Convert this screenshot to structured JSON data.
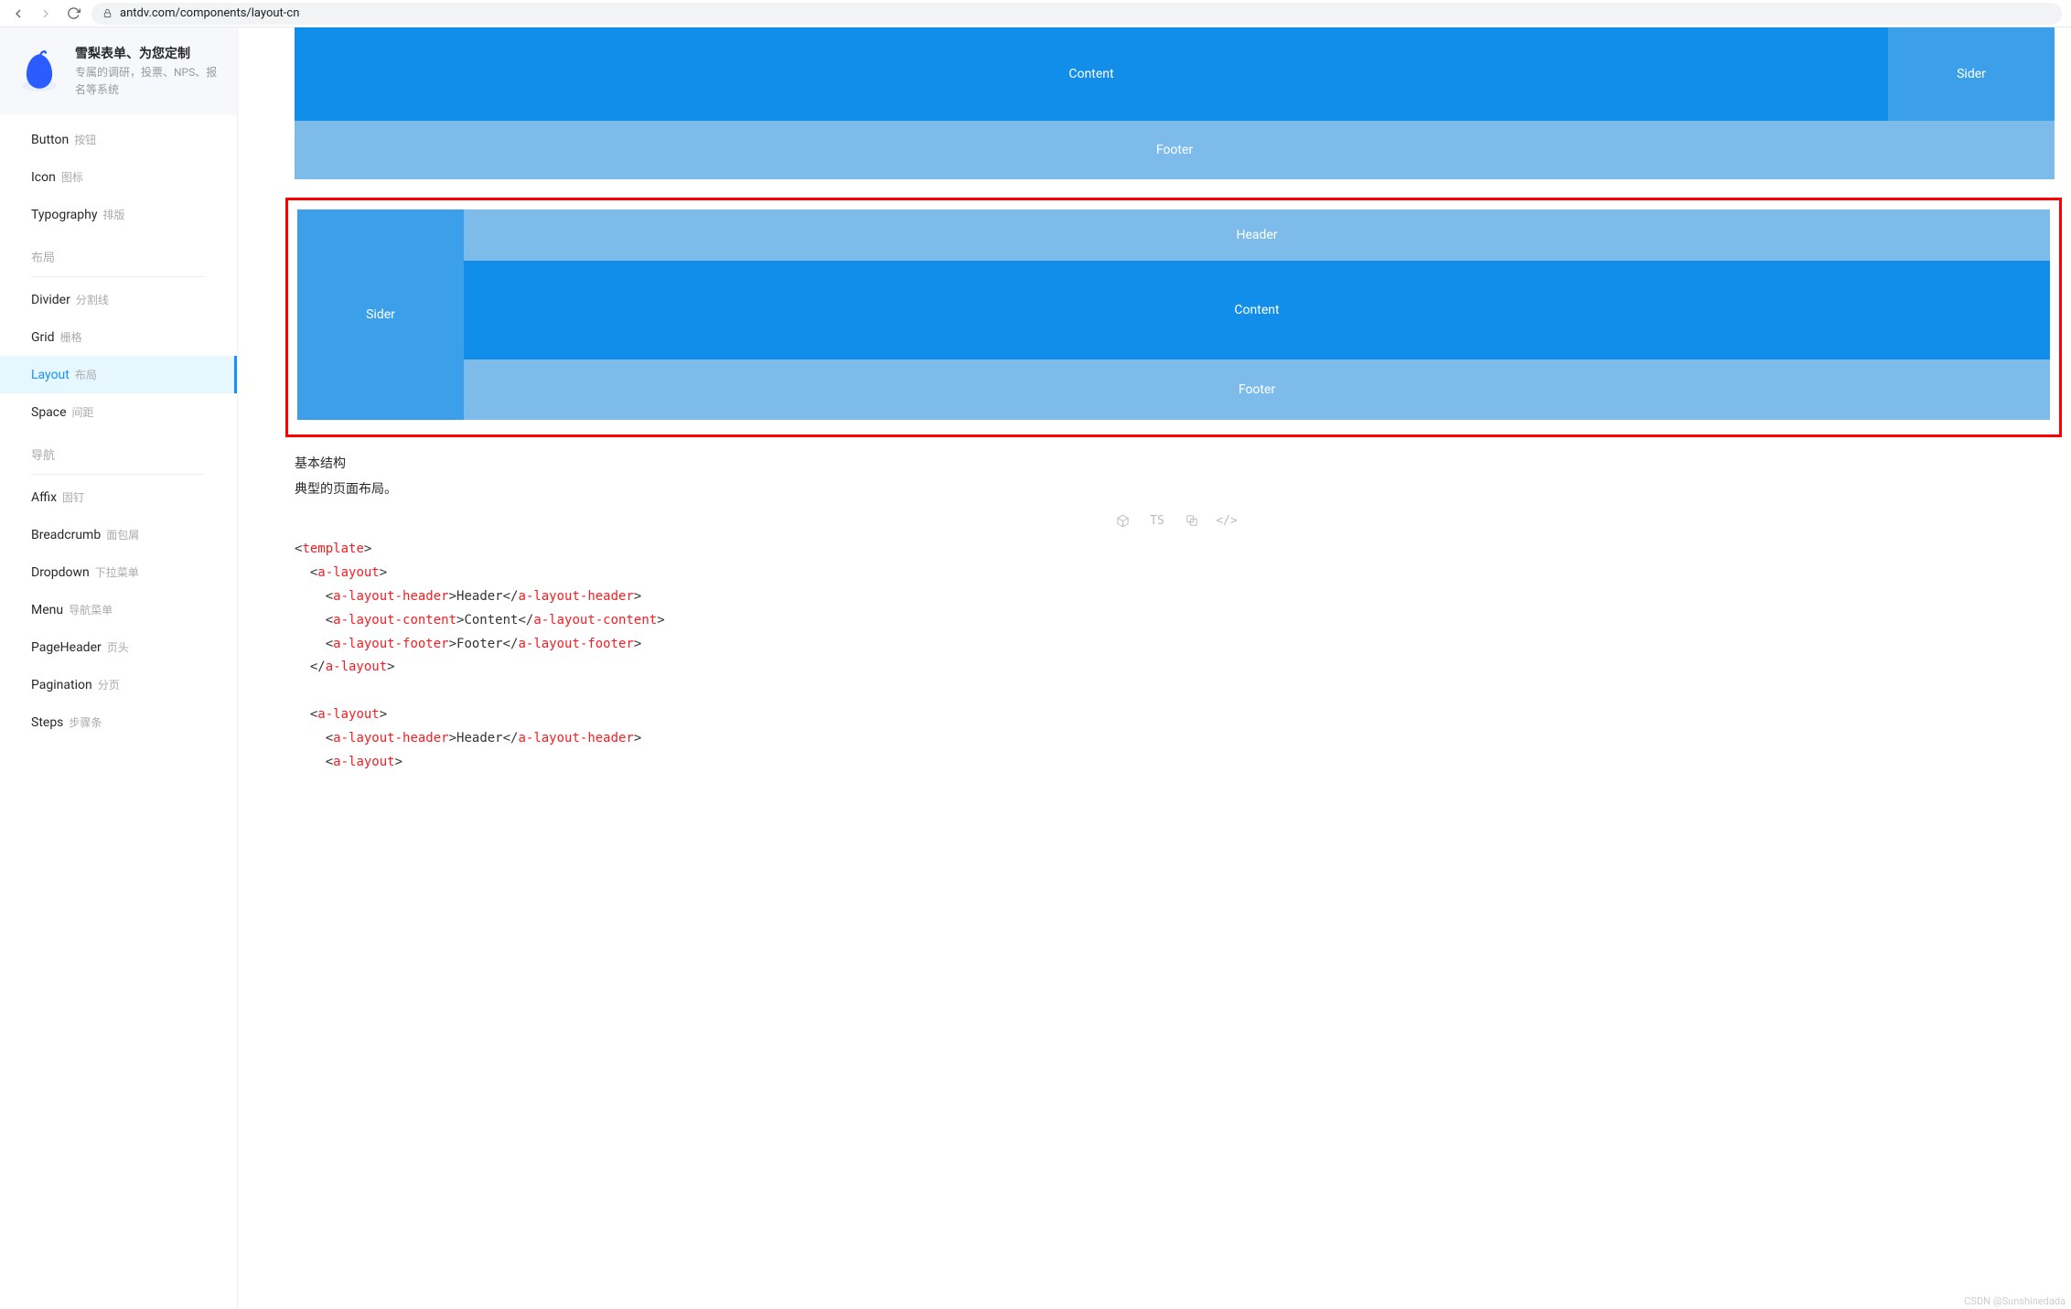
{
  "browser": {
    "url": "antdv.com/components/layout-cn"
  },
  "promo": {
    "title": "雪梨表单、为您定制",
    "desc": "专属的调研，投票、NPS、报名等系统"
  },
  "menu": {
    "items_general": [
      {
        "en": "Button",
        "cn": "按钮"
      },
      {
        "en": "Icon",
        "cn": "图标"
      },
      {
        "en": "Typography",
        "cn": "排版"
      }
    ],
    "group_layout_title": "布局",
    "items_layout": [
      {
        "en": "Divider",
        "cn": "分割线"
      },
      {
        "en": "Grid",
        "cn": "栅格"
      },
      {
        "en": "Layout",
        "cn": "布局",
        "active": true
      },
      {
        "en": "Space",
        "cn": "间距"
      }
    ],
    "group_nav_title": "导航",
    "items_nav": [
      {
        "en": "Affix",
        "cn": "固钉"
      },
      {
        "en": "Breadcrumb",
        "cn": "面包屑"
      },
      {
        "en": "Dropdown",
        "cn": "下拉菜单"
      },
      {
        "en": "Menu",
        "cn": "导航菜单"
      },
      {
        "en": "PageHeader",
        "cn": "页头"
      },
      {
        "en": "Pagination",
        "cn": "分页"
      },
      {
        "en": "Steps",
        "cn": "步骤条"
      }
    ]
  },
  "demo_labels": {
    "header": "Header",
    "content": "Content",
    "footer": "Footer",
    "sider": "Sider"
  },
  "section": {
    "title": "基本结构",
    "desc": "典型的页面布局。"
  },
  "toolbar": {
    "sandbox_icon": "sandbox",
    "ts_label": "TS",
    "copy_icon": "copy",
    "code_icon": "</>"
  },
  "code": {
    "lines": [
      {
        "indent": 0,
        "type": "open",
        "tag": "template"
      },
      {
        "indent": 1,
        "type": "open",
        "tag": "a-layout"
      },
      {
        "indent": 2,
        "type": "pair",
        "tag": "a-layout-header",
        "text": "Header"
      },
      {
        "indent": 2,
        "type": "pair",
        "tag": "a-layout-content",
        "text": "Content"
      },
      {
        "indent": 2,
        "type": "pair",
        "tag": "a-layout-footer",
        "text": "Footer"
      },
      {
        "indent": 1,
        "type": "close",
        "tag": "a-layout"
      },
      {
        "indent": 0,
        "type": "blank"
      },
      {
        "indent": 1,
        "type": "open",
        "tag": "a-layout"
      },
      {
        "indent": 2,
        "type": "pair",
        "tag": "a-layout-header",
        "text": "Header"
      },
      {
        "indent": 2,
        "type": "open",
        "tag": "a-layout"
      }
    ]
  },
  "watermark": "CSDN @Sunshinedada"
}
